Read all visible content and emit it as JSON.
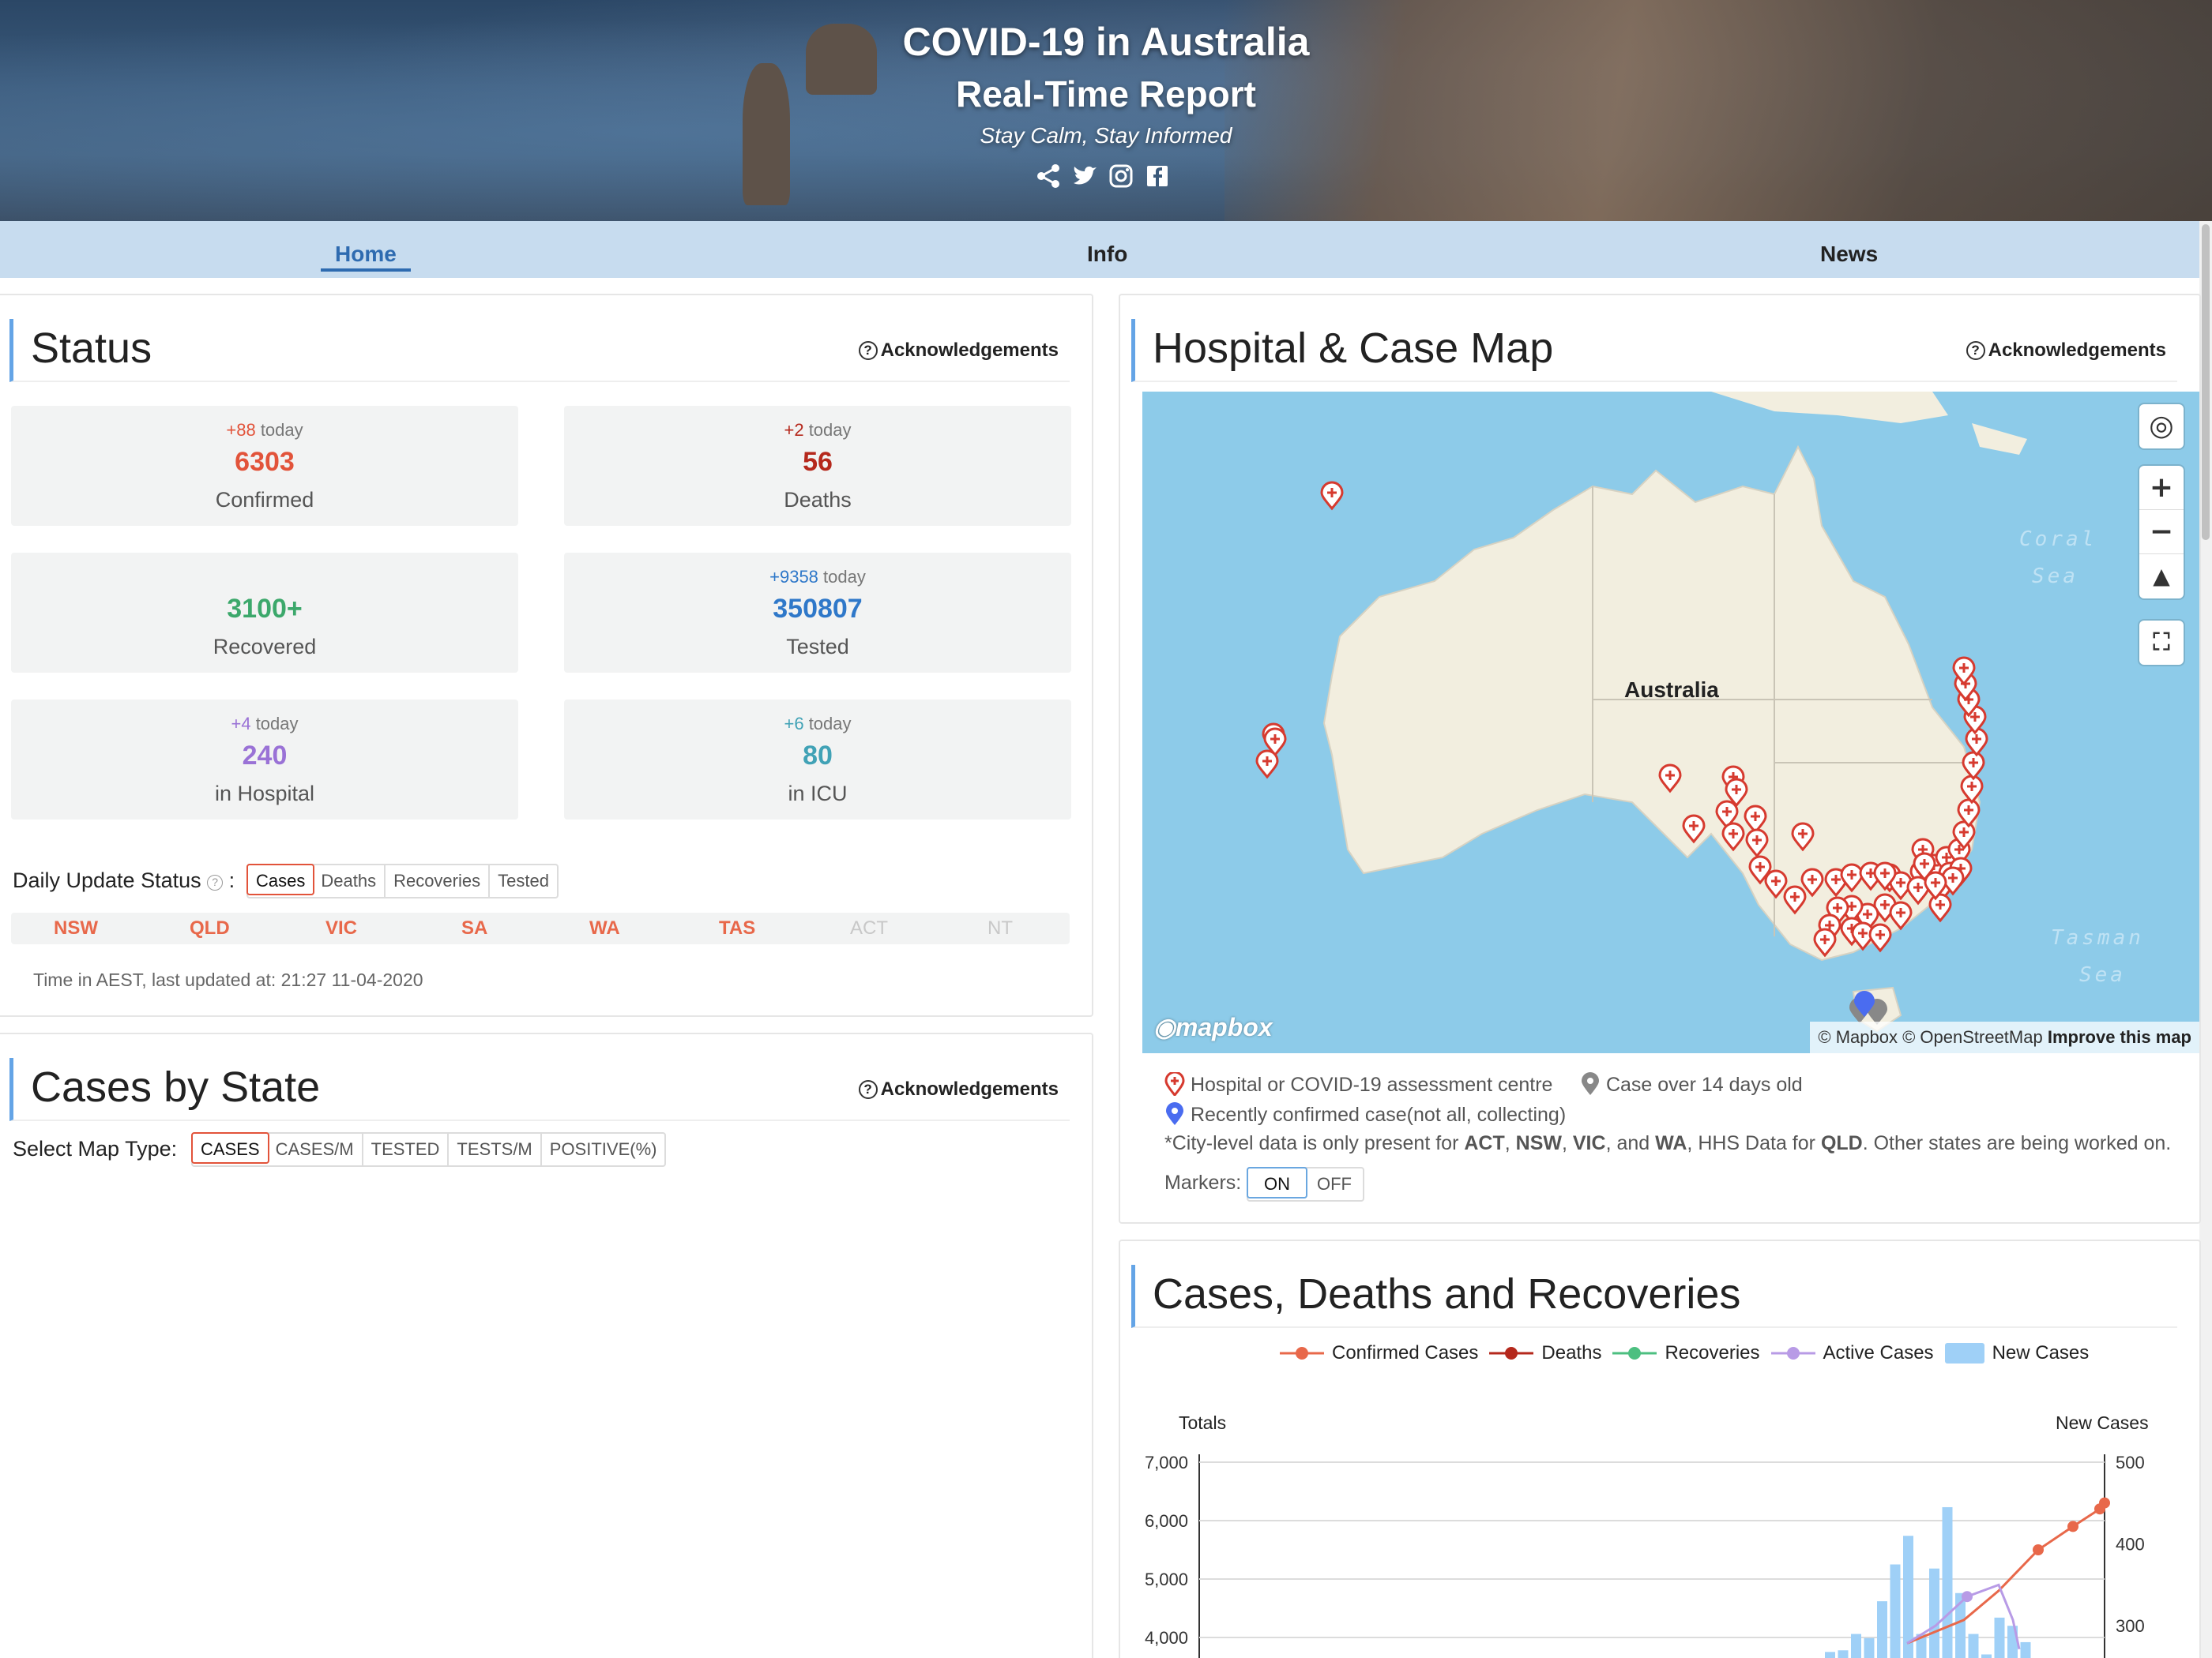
{
  "banner": {
    "title_line1": "COVID-19 in Australia",
    "title_line2": "Real-Time Report",
    "tagline": "Stay Calm, Stay Informed",
    "social_icons": [
      "share-icon",
      "twitter-icon",
      "instagram-icon",
      "facebook-icon"
    ]
  },
  "nav": {
    "tabs": [
      {
        "label": "Home",
        "active": true
      },
      {
        "label": "Info",
        "active": false
      },
      {
        "label": "News",
        "active": false
      }
    ]
  },
  "status": {
    "title": "Status",
    "ack": "Acknowledgements",
    "stats": [
      {
        "delta": "+88",
        "delta_suffix": "today",
        "value": "6303",
        "label": "Confirmed",
        "color": "#e2533a"
      },
      {
        "delta": "+2",
        "delta_suffix": "today",
        "value": "56",
        "label": "Deaths",
        "color": "#b5281c"
      },
      {
        "delta": "",
        "delta_suffix": "",
        "value": "3100+",
        "label": "Recovered",
        "color": "#3ca86b"
      },
      {
        "delta": "+9358",
        "delta_suffix": "today",
        "value": "350807",
        "label": "Tested",
        "color": "#2f78c9"
      },
      {
        "delta": "+4",
        "delta_suffix": "today",
        "value": "240",
        "label": "in Hospital",
        "color": "#9a72d6"
      },
      {
        "delta": "+6",
        "delta_suffix": "today",
        "value": "80",
        "label": "in ICU",
        "color": "#41a2b6"
      }
    ],
    "daily_update_label": "Daily Update Status",
    "daily_update_colon": ":",
    "daily_update_tabs": [
      "Cases",
      "Deaths",
      "Recoveries",
      "Tested"
    ],
    "daily_update_selected": "Cases",
    "states": [
      {
        "name": "NSW",
        "updated": true
      },
      {
        "name": "QLD",
        "updated": true
      },
      {
        "name": "VIC",
        "updated": true
      },
      {
        "name": "SA",
        "updated": true
      },
      {
        "name": "WA",
        "updated": true
      },
      {
        "name": "TAS",
        "updated": true
      },
      {
        "name": "ACT",
        "updated": false
      },
      {
        "name": "NT",
        "updated": false
      }
    ],
    "last_updated": "Time in AEST, last updated at: 21:27 11-04-2020"
  },
  "cases_by_state": {
    "title": "Cases by State",
    "ack": "Acknowledgements",
    "select_label": "Select Map Type:",
    "map_types": [
      "CASES",
      "CASES/M",
      "TESTED",
      "TESTS/M",
      "POSITIVE(%)"
    ],
    "selected": "CASES"
  },
  "map_card": {
    "title": "Hospital & Case Map",
    "ack": "Acknowledgements",
    "map": {
      "country_label": "Australia",
      "sea_labels": [
        "Coral Sea",
        "Tasman Sea"
      ],
      "logo": "mapbox",
      "attribution": "© Mapbox © OpenStreetMap",
      "improve": "Improve this map",
      "controls": [
        "locate-icon",
        "zoom-in-icon",
        "zoom-out-icon",
        "compass-icon",
        "fullscreen-icon"
      ]
    },
    "legend": {
      "hospital": "Hospital or COVID-19 assessment centre",
      "old_case": "Case over 14 days old",
      "recent_case": "Recently confirmed case(not all, collecting)",
      "note_prefix": "*City-level data is only present for",
      "note_states": [
        "ACT",
        "NSW",
        "VIC"
      ],
      "note_and": "and",
      "note_wa": "WA",
      "note_hhs": ", HHS Data for",
      "note_qld": "QLD",
      "note_suffix": ". Other states are being worked on."
    },
    "markers_label": "Markers:",
    "markers_options": [
      "ON",
      "OFF"
    ],
    "markers_selected": "ON"
  },
  "chart_card": {
    "title": "Cases, Deaths and Recoveries"
  },
  "chart_data": {
    "type": "line",
    "title": "",
    "legend": [
      {
        "name": "Confirmed Cases",
        "color": "#e8684a",
        "kind": "line"
      },
      {
        "name": "Deaths",
        "color": "#b5281c",
        "kind": "line"
      },
      {
        "name": "Recoveries",
        "color": "#4cbf80",
        "kind": "line"
      },
      {
        "name": "Active Cases",
        "color": "#b89be6",
        "kind": "line"
      },
      {
        "name": "New Cases",
        "color": "#9fd0f7",
        "kind": "bar"
      }
    ],
    "ylabel_left": "Totals",
    "ylabel_right": "New Cases",
    "y_left_ticks": [
      "7,000",
      "6,000",
      "5,000",
      "4,000"
    ],
    "y_right_ticks": [
      "500",
      "400",
      "300"
    ],
    "y_left_visible_range": [
      3800,
      7000
    ],
    "y_right_visible_range": [
      265,
      500
    ],
    "new_cases_bars": [
      268,
      270,
      290,
      285,
      330,
      375,
      410,
      290,
      370,
      445,
      340,
      290,
      265,
      310,
      300,
      280
    ],
    "confirmed_points": [
      3900,
      4300,
      4800,
      5500,
      5900,
      6200,
      6303
    ],
    "active_points": [
      3900,
      4200,
      4700,
      4900,
      4300,
      3800
    ]
  }
}
